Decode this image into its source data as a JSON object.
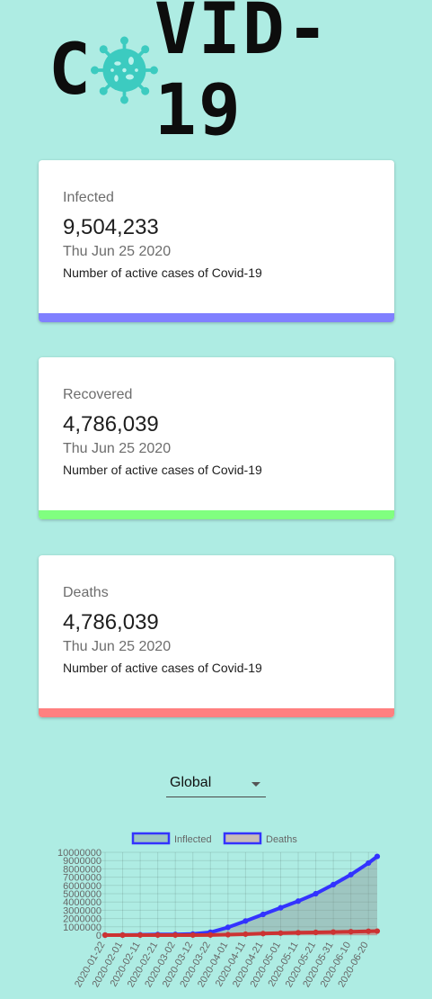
{
  "brand": {
    "logo_text_left": "C",
    "logo_text_right": "VID-19"
  },
  "cards": [
    {
      "title": "Infected",
      "value": "9,504,233",
      "date": "Thu Jun 25 2020",
      "description": "Number of active cases of Covid-19",
      "bar_color": "#8080ff"
    },
    {
      "title": "Recovered",
      "value": "4,786,039",
      "date": "Thu Jun 25 2020",
      "description": "Number of active cases of Covid-19",
      "bar_color": "#80ff80"
    },
    {
      "title": "Deaths",
      "value": "4,786,039",
      "date": "Thu Jun 25 2020",
      "description": "Number of active cases of Covid-19",
      "bar_color": "#ff8080"
    }
  ],
  "country_select": {
    "selected": "Global"
  },
  "chart_data": {
    "type": "line",
    "legend": [
      "Inflected",
      "Deaths"
    ],
    "legend_position": "top",
    "grid": true,
    "ylim": [
      0,
      10000000
    ],
    "y_ticks": [
      "10000000",
      "9000000",
      "8000000",
      "7000000",
      "6000000",
      "5000000",
      "4000000",
      "3000000",
      "2000000",
      "1000000",
      "0"
    ],
    "x_ticks": [
      "2020-01-22",
      "2020-02-01",
      "2020-02-11",
      "2020-02-21",
      "2020-03-02",
      "2020-03-12",
      "2020-03-22",
      "2020-04-01",
      "2020-04-11",
      "2020-04-21",
      "2020-05-01",
      "2020-05-11",
      "2020-05-21",
      "2020-05-31",
      "2020-06-10",
      "2020-06-20"
    ],
    "series": [
      {
        "name": "Inflected",
        "line_color": "#3333ff",
        "fill_color": "rgba(128,128,128,0.35)",
        "x": [
          "2020-01-22",
          "2020-02-01",
          "2020-02-11",
          "2020-02-21",
          "2020-03-02",
          "2020-03-12",
          "2020-03-22",
          "2020-04-01",
          "2020-04-11",
          "2020-04-21",
          "2020-05-01",
          "2020-05-11",
          "2020-05-21",
          "2020-05-31",
          "2020-06-10",
          "2020-06-20",
          "2020-06-25"
        ],
        "values": [
          600,
          12000,
          45000,
          77000,
          90000,
          130000,
          340000,
          940000,
          1700000,
          2500000,
          3300000,
          4100000,
          5000000,
          6100000,
          7300000,
          8700000,
          9500000
        ]
      },
      {
        "name": "Deaths",
        "line_color": "#cc3333",
        "fill_color": "rgba(255,100,100,0.35)",
        "x": [
          "2020-01-22",
          "2020-02-01",
          "2020-02-11",
          "2020-02-21",
          "2020-03-02",
          "2020-03-12",
          "2020-03-22",
          "2020-04-01",
          "2020-04-11",
          "2020-04-21",
          "2020-05-01",
          "2020-05-11",
          "2020-05-21",
          "2020-05-31",
          "2020-06-10",
          "2020-06-20",
          "2020-06-25"
        ],
        "values": [
          17,
          260,
          1100,
          2300,
          3100,
          4700,
          15000,
          51000,
          110000,
          180000,
          240000,
          290000,
          330000,
          370000,
          410000,
          465000,
          485000
        ]
      }
    ]
  }
}
